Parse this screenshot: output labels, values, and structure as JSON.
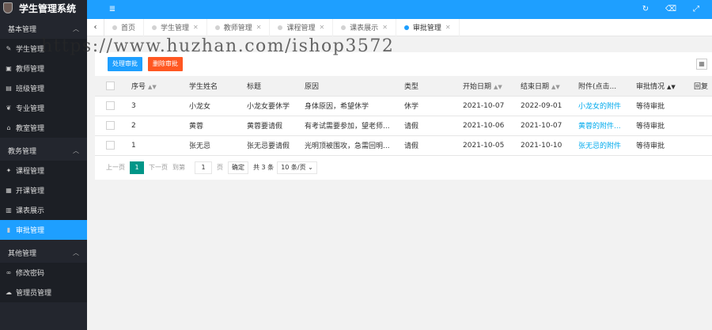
{
  "app": {
    "title": "学生管理系统"
  },
  "sidebar": {
    "groups": [
      {
        "label": "基本管理",
        "items": [
          {
            "label": "学生管理",
            "icon": "pencil-icon"
          },
          {
            "label": "教师管理",
            "icon": "image-icon"
          },
          {
            "label": "班级管理",
            "icon": "list-icon"
          },
          {
            "label": "专业管理",
            "icon": "leaf-icon"
          },
          {
            "label": "教室管理",
            "icon": "bank-icon"
          }
        ]
      },
      {
        "label": "教务管理",
        "items": [
          {
            "label": "课程管理",
            "icon": "wrench-icon"
          },
          {
            "label": "开课管理",
            "icon": "calendar-icon"
          },
          {
            "label": "课表展示",
            "icon": "table-icon"
          },
          {
            "label": "审批管理",
            "icon": "book-icon",
            "active": true
          }
        ]
      },
      {
        "label": "其他管理",
        "items": [
          {
            "label": "修改密码",
            "icon": "link-icon"
          },
          {
            "label": "管理员管理",
            "icon": "cloud-icon"
          }
        ]
      }
    ]
  },
  "header": {
    "menu_icon": "≣",
    "refresh_icon": "↻",
    "trash_icon": "🗑",
    "expand_icon": "⤢"
  },
  "tabs": [
    {
      "label": "首页",
      "closable": false
    },
    {
      "label": "学生管理",
      "closable": true
    },
    {
      "label": "教师管理",
      "closable": true
    },
    {
      "label": "课程管理",
      "closable": true
    },
    {
      "label": "课表展示",
      "closable": true
    },
    {
      "label": "审批管理",
      "closable": true,
      "active": true
    }
  ],
  "watermark": "https://www.huzhan.com/ishop3572",
  "toolbar": {
    "process_label": "处理审批",
    "delete_label": "删除审批"
  },
  "table": {
    "columns": [
      "序号",
      "学生姓名",
      "标题",
      "原因",
      "类型",
      "开始日期",
      "结束日期",
      "附件(点击...",
      "审批情况",
      "回复"
    ],
    "rows": [
      [
        "3",
        "小龙女",
        "小龙女要休学",
        "身体原因，希望休学",
        "休学",
        "2021-10-07",
        "2022-09-01",
        "小龙女的附件",
        "等待审批",
        ""
      ],
      [
        "2",
        "黄蓉",
        "黄蓉要请假",
        "有考试需要参加，望老师...",
        "请假",
        "2021-10-06",
        "2021-10-07",
        "黄蓉的附件...",
        "等待审批",
        ""
      ],
      [
        "1",
        "张无忌",
        "张无忌要请假",
        "光明顶被围攻，急需回明...",
        "请假",
        "2021-10-05",
        "2021-10-10",
        "张无忌的附件",
        "等待审批",
        ""
      ]
    ]
  },
  "pager": {
    "prev": "上一页",
    "current": "1",
    "next": "下一页",
    "goto": "到第",
    "goto_value": "1",
    "page_unit": "页",
    "confirm": "确定",
    "total": "共 3 条",
    "page_size": "10 条/页"
  },
  "colors": {
    "accent": "#1e9fff",
    "danger": "#ff5722",
    "pager_active": "#009688",
    "sidebar_bg": "#23262e"
  }
}
